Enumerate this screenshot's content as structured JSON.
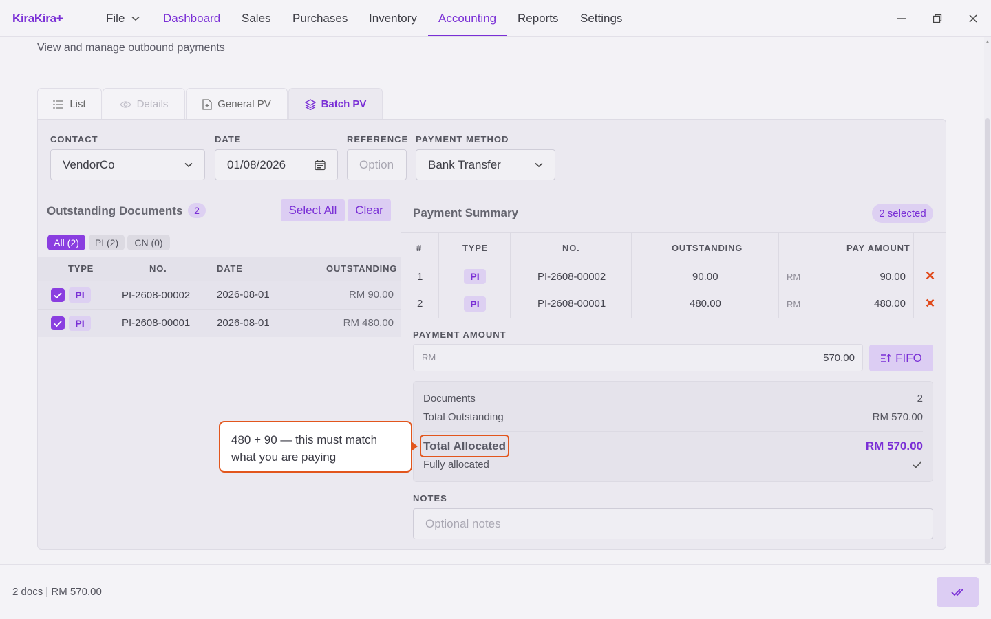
{
  "app": {
    "logo": "KiraKira+"
  },
  "menu": {
    "file": "File",
    "items": [
      "Dashboard",
      "Sales",
      "Purchases",
      "Inventory",
      "Accounting",
      "Reports",
      "Settings"
    ],
    "active": "Accounting"
  },
  "page": {
    "subtitle": "View and manage outbound payments"
  },
  "tabs": [
    {
      "label": "List",
      "icon": "list-icon",
      "state": "normal"
    },
    {
      "label": "Details",
      "icon": "eye-icon",
      "state": "disabled"
    },
    {
      "label": "General PV",
      "icon": "document-plus-icon",
      "state": "normal"
    },
    {
      "label": "Batch PV",
      "icon": "layers-icon",
      "state": "active"
    }
  ],
  "form": {
    "contact_label": "CONTACT",
    "contact_value": "VendorCo",
    "date_label": "DATE",
    "date_value": "01/08/2026",
    "reference_label": "REFERENCE",
    "reference_placeholder": "Option",
    "method_label": "PAYMENT METHOD",
    "method_value": "Bank Transfer"
  },
  "outstanding": {
    "title": "Outstanding Documents",
    "count": "2",
    "select_all": "Select All",
    "clear": "Clear",
    "filters": [
      "All (2)",
      "PI (2)",
      "CN (0)"
    ],
    "headers": {
      "type": "TYPE",
      "no": "NO.",
      "date": "DATE",
      "outstanding": "OUTSTANDING"
    },
    "rows": [
      {
        "type": "PI",
        "no": "PI-2608-00002",
        "date": "2026-08-01",
        "amount": "RM 90.00"
      },
      {
        "type": "PI",
        "no": "PI-2608-00001",
        "date": "2026-08-01",
        "amount": "RM 480.00"
      }
    ]
  },
  "summary": {
    "title": "Payment Summary",
    "selected": "2 selected",
    "headers": {
      "idx": "#",
      "type": "TYPE",
      "no": "NO.",
      "outstanding": "OUTSTANDING",
      "pay": "PAY AMOUNT"
    },
    "currency": "RM",
    "rows": [
      {
        "idx": "1",
        "type": "PI",
        "no": "PI-2608-00002",
        "outstanding": "90.00",
        "pay": "90.00"
      },
      {
        "idx": "2",
        "type": "PI",
        "no": "PI-2608-00001",
        "outstanding": "480.00",
        "pay": "480.00"
      }
    ],
    "payment_amount_label": "PAYMENT AMOUNT",
    "payment_amount_value": "570.00",
    "fifo": "FIFO",
    "documents_label": "Documents",
    "documents_value": "2",
    "total_outstanding_label": "Total Outstanding",
    "total_outstanding_value": "RM 570.00",
    "total_allocated_label": "Total Allocated",
    "total_allocated_value": "RM 570.00",
    "status": "Fully allocated",
    "notes_label": "NOTES",
    "notes_placeholder": "Optional notes"
  },
  "callout": {
    "text": "480 + 90 — this must match what you are paying"
  },
  "footer": {
    "summary": "2 docs | RM 570.00"
  },
  "colors": {
    "accent": "#7a2fd6",
    "highlight": "#e2561d",
    "remove": "#e04a1c"
  }
}
